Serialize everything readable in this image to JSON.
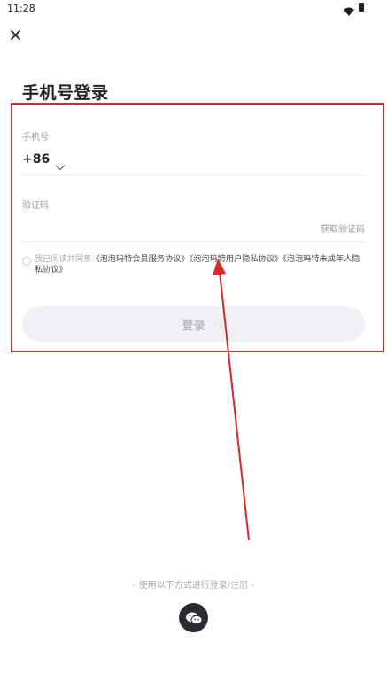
{
  "status_bar": {
    "time": "11:28",
    "icons": [
      "wifi-icon",
      "battery-icon"
    ]
  },
  "header": {
    "close_icon": "close-icon",
    "title": "手机号登录"
  },
  "form": {
    "phone_label": "手机号",
    "country_code": "+86",
    "phone_value": "",
    "code_label": "验证码",
    "code_value": "",
    "get_code_label": "获取验证码"
  },
  "agreement": {
    "prefix": "我已阅读并同意",
    "links": [
      "《泡泡玛特会员服务协议》",
      "《泡泡玛特用户隐私协议》",
      "《泡泡玛特未成年人隐私协议》"
    ],
    "checked": false
  },
  "login_button": {
    "label": "登录"
  },
  "other_login": {
    "text": "- 使用以下方式进行登录/注册 -",
    "icon": "wechat-icon"
  },
  "annotation": {
    "color": "#d42a2a"
  }
}
